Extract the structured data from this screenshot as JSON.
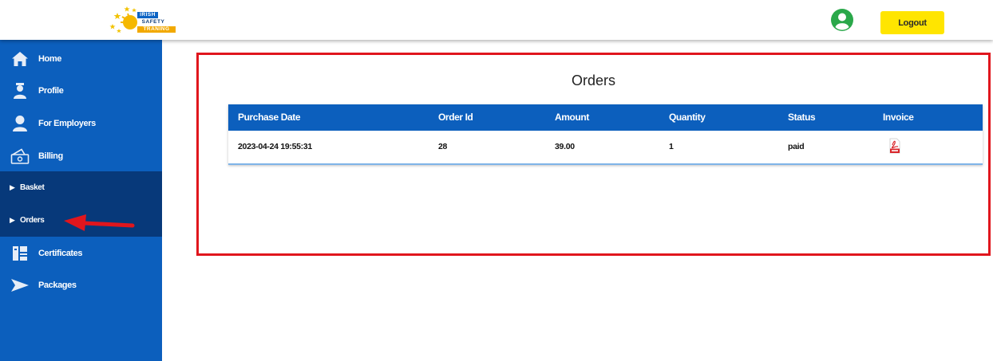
{
  "header": {
    "logo": {
      "line1": "IRISH",
      "line2": "SAFETY",
      "line3": "TRANING"
    },
    "avatar_icon": "user-circle-icon",
    "logout_label": "Logout"
  },
  "sidebar": {
    "items": [
      {
        "label": "Home",
        "icon": "home-icon"
      },
      {
        "label": "Profile",
        "icon": "profile-icon"
      },
      {
        "label": "For Employers",
        "icon": "employer-icon"
      },
      {
        "label": "Billing",
        "icon": "billing-icon"
      }
    ],
    "billing_sub": [
      {
        "label": "Basket",
        "icon": "caret-right-icon"
      },
      {
        "label": "Orders",
        "icon": "caret-right-icon"
      }
    ],
    "items_after": [
      {
        "label": "Certificates",
        "icon": "certificates-icon"
      },
      {
        "label": "Packages",
        "icon": "packages-icon"
      }
    ]
  },
  "main": {
    "title": "Orders",
    "table": {
      "columns": [
        "Purchase Date",
        "Order Id",
        "Amount",
        "Quantity",
        "Status",
        "Invoice"
      ],
      "rows": [
        {
          "purchase_date": "2023-04-24 19:55:31",
          "order_id": "28",
          "amount": "39.00",
          "quantity": "1",
          "status": "paid",
          "invoice_icon": "pdf-icon"
        }
      ]
    }
  },
  "colors": {
    "sidebar": "#0c5fbd",
    "sidebar_sub": "#07397a",
    "logout": "#ffe500",
    "highlight": "#e0161d",
    "avatar": "#2aa84a"
  }
}
